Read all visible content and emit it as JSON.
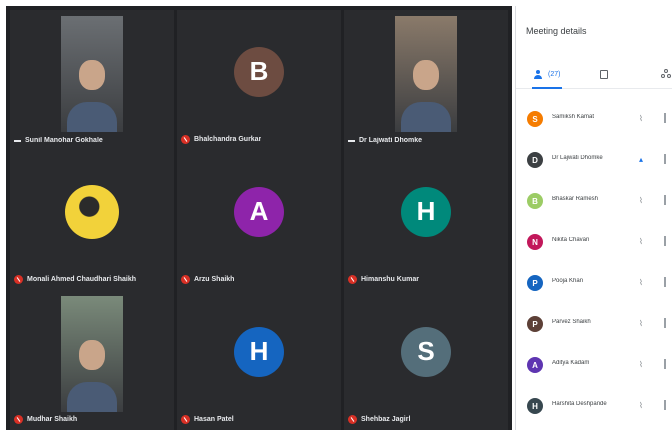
{
  "meeting": {
    "panel_title": "Meeting details",
    "tabs": [
      {
        "label": "(27)",
        "icon": "people-icon",
        "active": true
      },
      {
        "label": "",
        "icon": "chat-icon",
        "active": false
      },
      {
        "label": "",
        "icon": "activities-icon",
        "active": false
      }
    ]
  },
  "tiles": [
    {
      "name": "Sunil Manohar Gokhale",
      "type": "video",
      "muted": false,
      "bg": "#6b6f73"
    },
    {
      "name": "Bhalchandra Gurkar",
      "initial": "B",
      "color": "#6d4c41",
      "type": "avatar",
      "muted": true
    },
    {
      "name": "Dr Lajwati Dhomke",
      "type": "video",
      "muted": false,
      "bg": "#8a7a6a"
    },
    {
      "name": "Monali Ahmed Chaudhari Shaikh",
      "type": "image",
      "muted": true,
      "bg": "#f2d23a"
    },
    {
      "name": "Arzu Shaikh",
      "initial": "A",
      "color": "#8e24aa",
      "type": "avatar",
      "muted": true
    },
    {
      "name": "Himanshu Kumar",
      "initial": "H",
      "color": "#00897b",
      "type": "avatar",
      "muted": true
    },
    {
      "name": "Mudhar Shaikh",
      "type": "video",
      "muted": true,
      "bg": "#7a8a7a"
    },
    {
      "name": "Hasan Patel",
      "initial": "H",
      "color": "#1565c0",
      "type": "avatar",
      "muted": true
    },
    {
      "name": "Shehbaz Jagirl",
      "initial": "S",
      "color": "#546e7a",
      "type": "avatar",
      "muted": true
    }
  ],
  "participants": [
    {
      "name": "Samiksh Kamat",
      "initial": "S",
      "color": "#f57c00",
      "mic": "muted"
    },
    {
      "name": "Dr Lajwati Dhomke",
      "initial": "D",
      "color": "#3c4043",
      "mic": "active"
    },
    {
      "name": "Bhaskar Ramesh",
      "initial": "B",
      "color": "#9ccc65",
      "mic": "muted"
    },
    {
      "name": "Nikita Chavan",
      "initial": "N",
      "color": "#c2185b",
      "mic": "muted"
    },
    {
      "name": "Pooja Khan",
      "initial": "P",
      "color": "#1565c0",
      "mic": "muted"
    },
    {
      "name": "Parvez Shaikh",
      "initial": "P",
      "color": "#5d4037",
      "mic": "muted"
    },
    {
      "name": "Aditya Kadam",
      "initial": "A",
      "color": "#5e35b1",
      "mic": "muted"
    },
    {
      "name": "Harshita Deshpande",
      "initial": "H",
      "color": "#37474f",
      "mic": "muted"
    }
  ]
}
